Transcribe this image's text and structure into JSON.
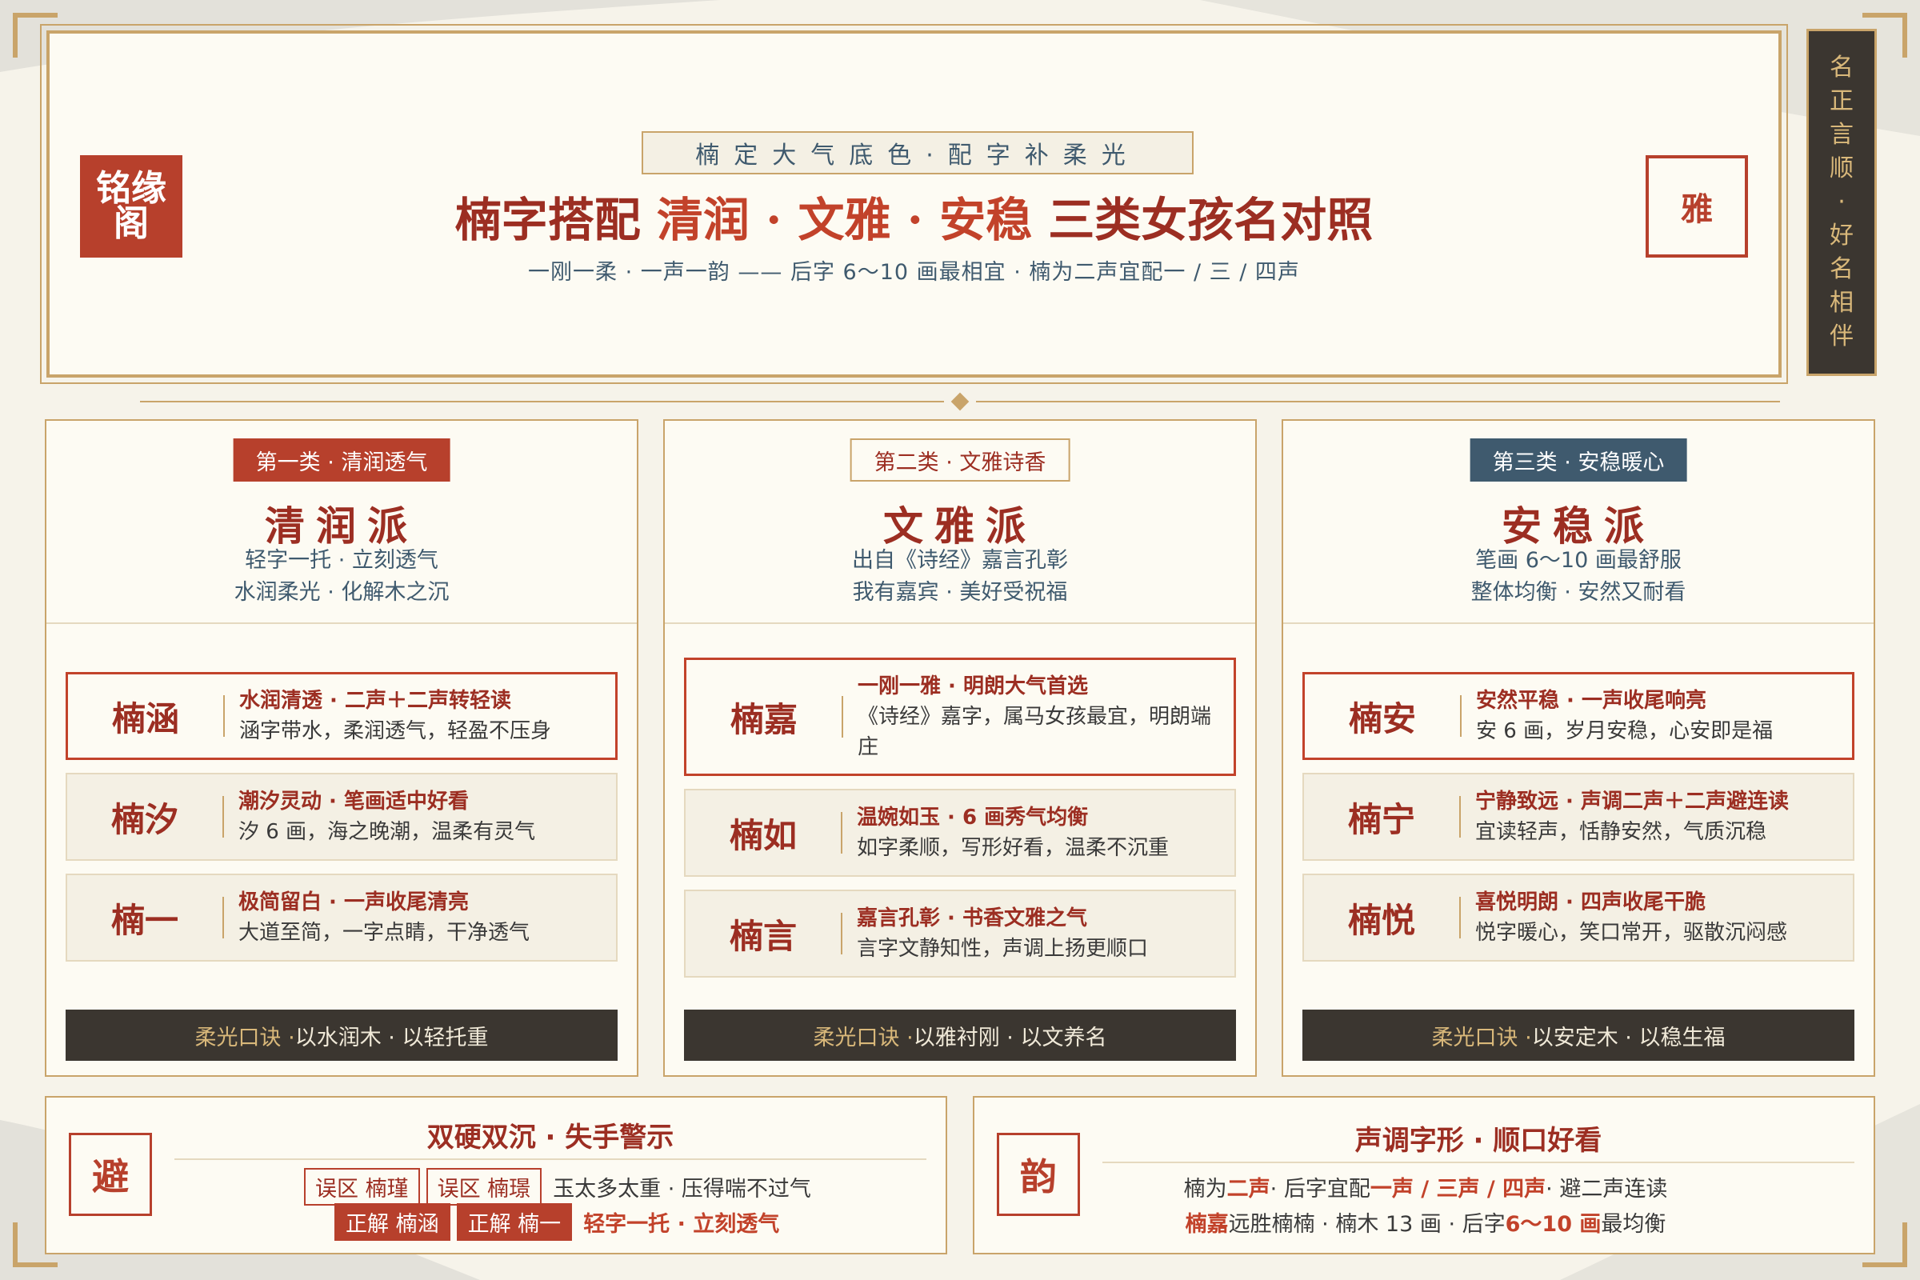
{
  "brand": {
    "seal_line1": "铭缘",
    "seal_line2": "阁",
    "right_seal": "雅"
  },
  "side_banner": [
    "名",
    "正",
    "言",
    "顺",
    "·",
    "好",
    "名",
    "相",
    "伴"
  ],
  "header": {
    "subtitle": "楠定大气底色·配字补柔光",
    "title_pre": "楠字搭配 ",
    "title_hl": "清润 · 文雅 · 安稳",
    "title_post": " 三类女孩名对照",
    "tagline": "一刚一柔 · 一声一韵 —— 后字 6～10 画最相宜 · 楠为二声宜配一 / 三 / 四声"
  },
  "cards": [
    {
      "tag": "第一类 · 清润透气",
      "title": "清润派",
      "desc1": "轻字一托 · 立刻透气",
      "desc2": "水润柔光 · 化解木之沉",
      "names": [
        {
          "name": "楠涵",
          "line1": "水润清透 · 二声＋二声转轻读",
          "line2": "涵字带水，柔润透气，轻盈不压身"
        },
        {
          "name": "楠汐",
          "line1": "潮汐灵动 · 笔画适中好看",
          "line2": "汐 6 画，海之晚潮，温柔有灵气"
        },
        {
          "name": "楠一",
          "line1": "极简留白 · 一声收尾清亮",
          "line2": "大道至简，一字点睛，干净透气"
        }
      ],
      "foot_gold": "柔光口诀 · ",
      "foot": "以水润木 · 以轻托重"
    },
    {
      "tag": "第二类 · 文雅诗香",
      "title": "文雅派",
      "desc1": "出自《诗经》嘉言孔彰",
      "desc2": "我有嘉宾 · 美好受祝福",
      "names": [
        {
          "name": "楠嘉",
          "line1": "一刚一雅 · 明朗大气首选",
          "line2": "《诗经》嘉字，属马女孩最宜，明朗端庄"
        },
        {
          "name": "楠如",
          "line1": "温婉如玉 · 6 画秀气均衡",
          "line2": "如字柔顺，写形好看，温柔不沉重"
        },
        {
          "name": "楠言",
          "line1": "嘉言孔彰 · 书香文雅之气",
          "line2": "言字文静知性，声调上扬更顺口"
        }
      ],
      "foot_gold": "柔光口诀 · ",
      "foot": "以雅衬刚 · 以文养名"
    },
    {
      "tag": "第三类 · 安稳暖心",
      "title": "安稳派",
      "desc1": "笔画 6～10 画最舒服",
      "desc2": "整体均衡 · 安然又耐看",
      "names": [
        {
          "name": "楠安",
          "line1": "安然平稳 · 一声收尾响亮",
          "line2": "安 6 画，岁月安稳，心安即是福"
        },
        {
          "name": "楠宁",
          "line1": "宁静致远 · 声调二声＋二声避连读",
          "line2": "宜读轻声，恬静安然，气质沉稳"
        },
        {
          "name": "楠悦",
          "line1": "喜悦明朗 · 四声收尾干脆",
          "line2": "悦字暖心，笑口常开，驱散沉闷感"
        }
      ],
      "foot_gold": "柔光口诀 · ",
      "foot": "以安定木 · 以稳生福"
    }
  ],
  "warning": {
    "seal": "避",
    "title": "双硬双沉 · 失手警示",
    "wrong1": "误区 楠瑾",
    "wrong2": "误区 楠璟",
    "wrong_note": "玉太多太重 · 压得喘不过气",
    "right1": "正解 楠涵",
    "right2": "正解 楠一",
    "right_note": "轻字一托 · 立刻透气"
  },
  "tone": {
    "seal": "韵",
    "title": "声调字形 · 顺口好看",
    "l1_a": "楠为",
    "l1_b": "二声",
    "l1_c": " · 后字宜配 ",
    "l1_d": "一声 / 三声 / 四声",
    "l1_e": " · 避二声连读",
    "l2_a": "楠嘉",
    "l2_b": "远胜楠楠 · 楠木 13 画 · 后字 ",
    "l2_c": "6～10 画",
    "l2_d": "最均衡"
  },
  "colors": {
    "accent_red": "#b7402c",
    "deep_red": "#9c2e22",
    "gold": "#c9a46a",
    "slate_blue": "#3f5a6e",
    "dark": "#3b3630",
    "paper": "#fdfbf3"
  }
}
